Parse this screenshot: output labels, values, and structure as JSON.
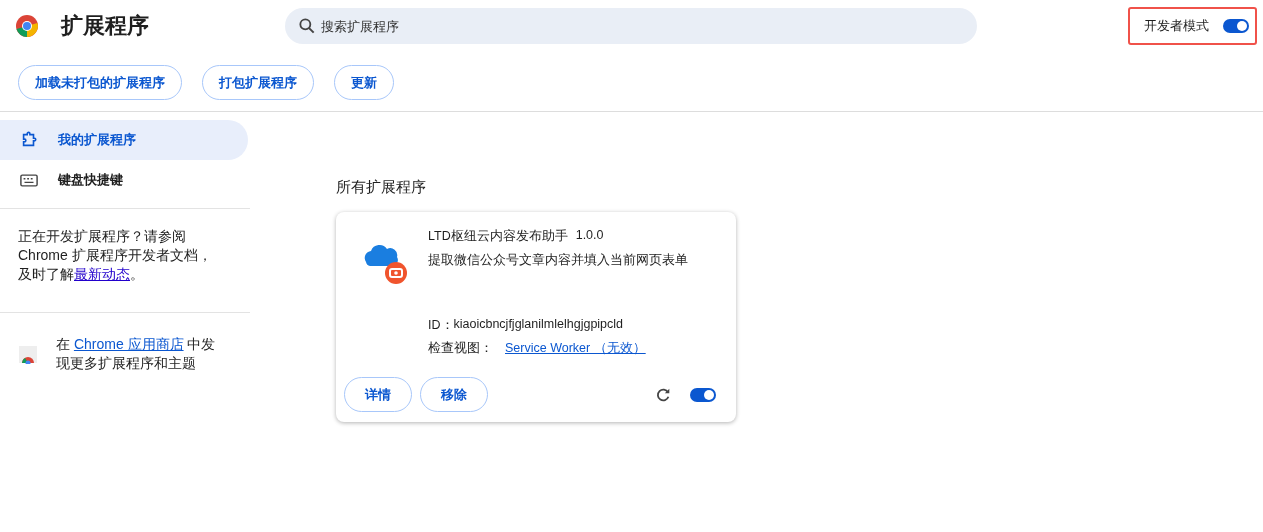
{
  "header": {
    "title": "扩展程序",
    "search": {
      "placeholder": "搜索扩展程序"
    },
    "developer_mode": {
      "label": "开发者模式",
      "on": true,
      "highlighted": true
    }
  },
  "toolbar": {
    "buttons": [
      "加载未打包的扩展程序",
      "打包扩展程序",
      "更新"
    ]
  },
  "sidebar": {
    "items": [
      {
        "label": "我的扩展程序",
        "kind": "extensions",
        "selected": true
      },
      {
        "label": "键盘快捷键",
        "kind": "shortcuts",
        "selected": false
      }
    ],
    "dev_note": {
      "before": "正在开发扩展程序？请参阅 Chrome 扩展程序开发者文档，及时了解",
      "link": "最新动态",
      "after": "。"
    },
    "store_note": {
      "before": "在 ",
      "link": "Chrome 应用商店",
      "after": " 中发现更多扩展程序和主题"
    }
  },
  "section_title": "所有扩展程序",
  "extensions": [
    {
      "name": "LTD枢纽云内容发布助手",
      "version": "1.0.0",
      "description": "提取微信公众号文章内容并填入当前网页表单",
      "id_label": "ID：",
      "id": "kiaoicbncjfjglanilmlelhgjgpipcld",
      "inspect_label": "检查视图：",
      "inspect_link": "Service Worker （无效）",
      "buttons": [
        "详情",
        "移除"
      ],
      "enabled": true
    }
  ]
}
